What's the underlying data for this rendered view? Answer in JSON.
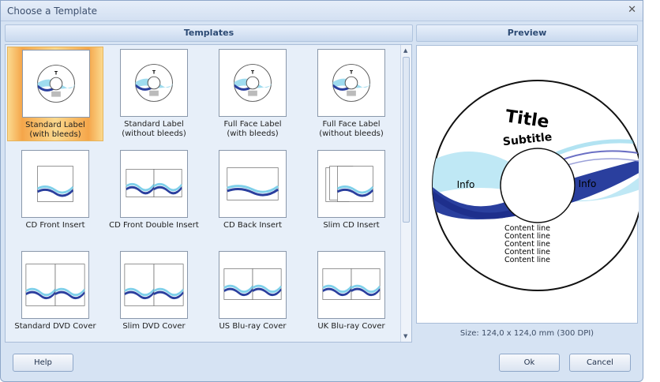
{
  "dialog": {
    "title": "Choose a Template"
  },
  "panels": {
    "templates": "Templates",
    "preview": "Preview"
  },
  "templates": [
    {
      "l1": "Standard Label",
      "l2": "(with bleeds)",
      "kind": "cd",
      "selected": true
    },
    {
      "l1": "Standard Label",
      "l2": "(without bleeds)",
      "kind": "cd"
    },
    {
      "l1": "Full Face Label",
      "l2": "(with bleeds)",
      "kind": "cd"
    },
    {
      "l1": "Full Face Label",
      "l2": "(without bleeds)",
      "kind": "cd"
    },
    {
      "l1": "CD Front Insert",
      "l2": "",
      "kind": "front"
    },
    {
      "l1": "CD Front Double Insert",
      "l2": "",
      "kind": "double"
    },
    {
      "l1": "CD Back Insert",
      "l2": "",
      "kind": "back"
    },
    {
      "l1": "Slim CD Insert",
      "l2": "",
      "kind": "slim"
    },
    {
      "l1": "Standard DVD Cover",
      "l2": "",
      "kind": "dvd"
    },
    {
      "l1": "Slim DVD Cover",
      "l2": "",
      "kind": "dvd"
    },
    {
      "l1": "US Blu-ray Cover",
      "l2": "",
      "kind": "bluray"
    },
    {
      "l1": "UK Blu-ray Cover",
      "l2": "",
      "kind": "bluray"
    }
  ],
  "preview_disc": {
    "title": "Title",
    "subtitle": "Subtitle",
    "info_left": "Info",
    "info_right": "Info",
    "content_lines": [
      "Content line",
      "Content line",
      "Content line",
      "Content line",
      "Content line"
    ]
  },
  "size_text": "Size: 124,0 x 124,0 mm (300 DPI)",
  "buttons": {
    "help": "Help",
    "ok": "Ok",
    "cancel": "Cancel"
  },
  "colors": {
    "selection": "#f5a64a",
    "wave_dark": "#1e2f8c",
    "wave_light": "#7fd0ea"
  }
}
